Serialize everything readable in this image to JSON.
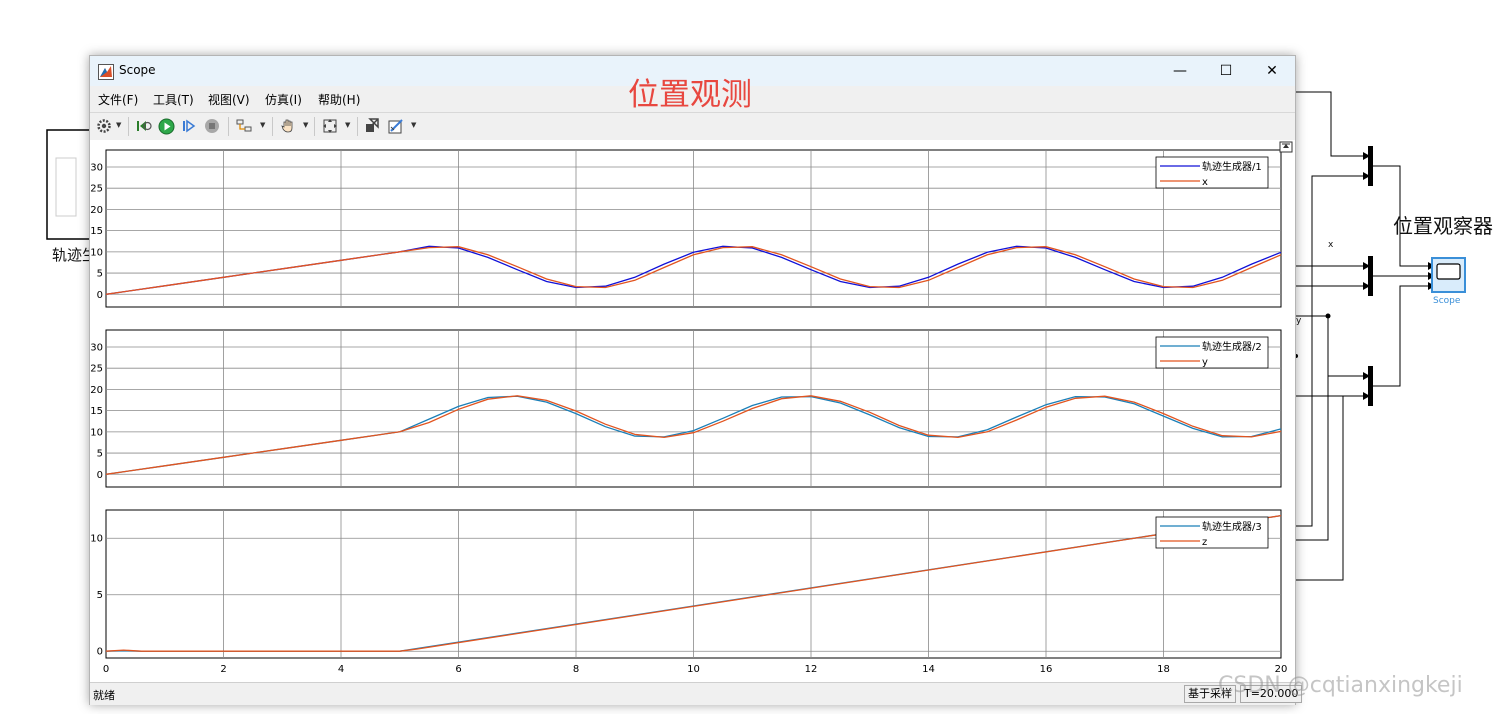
{
  "background": {
    "left_block_label": "轨迹生",
    "observer_label": "位置观察器",
    "signal_x_label": "x",
    "signal_y_label": "y",
    "scope_block_label": "Scope"
  },
  "watermark": "CSDN @cqtianxingkeji",
  "window": {
    "title": "Scope",
    "overlay_title": "位置观测",
    "controls": {
      "minimize": "—",
      "maximize": "☐",
      "close": "✕"
    },
    "menu": [
      "文件(F)",
      "工具(T)",
      "视图(V)",
      "仿真(I)",
      "帮助(H)"
    ],
    "status": {
      "left": "就绪",
      "sample_based": "基于采样",
      "time": "T=20.000"
    }
  },
  "toolbar_icons": [
    "settings-icon",
    "step-back-icon",
    "run-icon",
    "step-forward-icon",
    "stop-icon",
    "layout-icon",
    "pan-icon",
    "zoom-fit-icon",
    "highlight-icon",
    "style-icon"
  ],
  "colors": {
    "ref_x": "#1010d8",
    "ref_yz": "#1a7fb8",
    "obs": "#e2541f",
    "overlay_title": "#e8473f",
    "scope_block": "#3a8fd8"
  },
  "chart_data": [
    {
      "type": "line",
      "xlim": [
        0,
        20
      ],
      "ylim": [
        -3,
        34
      ],
      "yticks": [
        0,
        5,
        10,
        15,
        20,
        25,
        30
      ],
      "xticks": [
        0,
        2,
        4,
        6,
        8,
        10,
        12,
        14,
        16,
        18,
        20
      ],
      "grid": true,
      "legend_position": "top-right",
      "series": [
        {
          "name": "轨迹生成器/1",
          "color": "#1010d8",
          "x": [
            0,
            1,
            2,
            3,
            4,
            5,
            5.5,
            6,
            6.5,
            7,
            7.5,
            8,
            8.5,
            9,
            9.5,
            10,
            10.5,
            11,
            11.5,
            12,
            12.5,
            13,
            13.5,
            14,
            14.5,
            15,
            15.5,
            16,
            16.5,
            17,
            17.5,
            18,
            18.5,
            19,
            19.5,
            20
          ],
          "y": [
            0,
            2,
            4,
            6,
            8,
            10,
            11.3,
            10.9,
            8.7,
            5.8,
            3,
            1.6,
            1.9,
            4,
            7.1,
            9.9,
            11.3,
            10.9,
            8.7,
            5.8,
            3,
            1.6,
            1.9,
            4,
            7.1,
            9.9,
            11.3,
            10.9,
            8.7,
            5.8,
            3,
            1.6,
            1.9,
            4,
            7.1,
            9.9
          ]
        },
        {
          "name": "x",
          "color": "#e2541f",
          "x": [
            0,
            1,
            2,
            3,
            4,
            5,
            5.5,
            6,
            6.5,
            7,
            7.5,
            8,
            8.5,
            9,
            9.5,
            10,
            10.5,
            11,
            11.5,
            12,
            12.5,
            13,
            13.5,
            14,
            14.5,
            15,
            15.5,
            16,
            16.5,
            17,
            17.5,
            18,
            18.5,
            19,
            19.5,
            20
          ],
          "y": [
            0,
            2,
            4,
            6,
            8,
            10,
            11,
            11.2,
            9.3,
            6.5,
            3.6,
            1.8,
            1.6,
            3.3,
            6.3,
            9.3,
            11,
            11.2,
            9.3,
            6.5,
            3.6,
            1.8,
            1.6,
            3.3,
            6.3,
            9.3,
            11,
            11.2,
            9.3,
            6.5,
            3.6,
            1.8,
            1.6,
            3.3,
            6.3,
            9.3
          ]
        }
      ]
    },
    {
      "type": "line",
      "xlim": [
        0,
        20
      ],
      "ylim": [
        -3,
        34
      ],
      "yticks": [
        0,
        5,
        10,
        15,
        20,
        25,
        30
      ],
      "xticks": [
        0,
        2,
        4,
        6,
        8,
        10,
        12,
        14,
        16,
        18,
        20
      ],
      "grid": true,
      "legend_position": "top-right",
      "series": [
        {
          "name": "轨迹生成器/2",
          "color": "#1a7fb8",
          "x": [
            0,
            1,
            2,
            3,
            4,
            5,
            5.5,
            6,
            6.5,
            7,
            7.5,
            8,
            8.5,
            9,
            9.5,
            10,
            10.5,
            11,
            11.5,
            12,
            12.5,
            13,
            13.5,
            14,
            14.5,
            15,
            15.5,
            16,
            16.5,
            17,
            17.5,
            18,
            18.5,
            19,
            19.5,
            20
          ],
          "y": [
            0,
            2,
            4,
            6,
            8,
            10,
            13,
            16,
            18.1,
            18.4,
            17,
            14.3,
            11.2,
            9,
            8.8,
            10.3,
            13.2,
            16.2,
            18.2,
            18.3,
            16.8,
            14,
            11,
            8.9,
            8.8,
            10.5,
            13.5,
            16.4,
            18.3,
            18.2,
            16.6,
            13.7,
            10.8,
            8.8,
            8.9,
            10.7
          ]
        },
        {
          "name": "y",
          "color": "#e2541f",
          "x": [
            0,
            1,
            2,
            3,
            4,
            5,
            5.5,
            6,
            6.5,
            7,
            7.5,
            8,
            8.5,
            9,
            9.5,
            10,
            10.5,
            11,
            11.5,
            12,
            12.5,
            13,
            13.5,
            14,
            14.5,
            15,
            15.5,
            16,
            16.5,
            17,
            17.5,
            18,
            18.5,
            19,
            19.5,
            20
          ],
          "y": [
            0,
            2,
            4,
            6,
            8,
            10,
            12.2,
            15.3,
            17.7,
            18.5,
            17.4,
            14.9,
            11.8,
            9.4,
            8.7,
            9.8,
            12.5,
            15.5,
            17.8,
            18.5,
            17.2,
            14.6,
            11.5,
            9.2,
            8.7,
            10,
            12.8,
            15.8,
            17.9,
            18.4,
            17,
            14.3,
            11.3,
            9.1,
            8.8,
            10.1
          ]
        }
      ]
    },
    {
      "type": "line",
      "xlim": [
        0,
        20
      ],
      "ylim": [
        -0.6,
        12.5
      ],
      "yticks": [
        0,
        5,
        10
      ],
      "xticks": [
        0,
        2,
        4,
        6,
        8,
        10,
        12,
        14,
        16,
        18,
        20
      ],
      "grid": true,
      "legend_position": "top-right",
      "series": [
        {
          "name": "轨迹生成器/3",
          "color": "#1a7fb8",
          "x": [
            0,
            0.3,
            0.6,
            5,
            20
          ],
          "y": [
            0,
            0.05,
            0,
            0,
            12
          ]
        },
        {
          "name": "z",
          "color": "#e2541f",
          "x": [
            0,
            0.3,
            0.6,
            5,
            5.3,
            20
          ],
          "y": [
            0,
            0.1,
            0,
            0,
            0.2,
            12
          ]
        }
      ]
    }
  ]
}
